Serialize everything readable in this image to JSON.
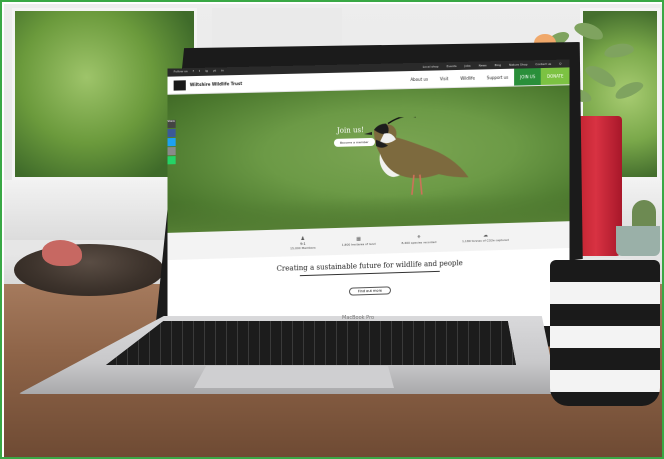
{
  "website": {
    "top_bar": {
      "social": [
        "Follow us",
        "f",
        "t",
        "ig",
        "yt",
        "in"
      ],
      "links": [
        "Local shop",
        "Events",
        "Jobs",
        "News",
        "Blog",
        "Nature Shop",
        "Contact us",
        "Q"
      ]
    },
    "nav": {
      "brand": "Wiltshire Wildlife Trust",
      "links": [
        "About us",
        "Visit",
        "Wildlife",
        "Support us"
      ],
      "join": "JOIN US",
      "donate": "DONATE"
    },
    "hero": {
      "share_label": "Share",
      "heading": "Join us!",
      "button": "Become a member"
    },
    "stats": [
      {
        "num": "9:1",
        "text": "15,000 Members"
      },
      {
        "num": "",
        "text": "1,800 hectares of land"
      },
      {
        "num": "",
        "text": "8,400 species recorded"
      },
      {
        "num": "",
        "text": "1,180 tonnes of CO2e captured"
      }
    ],
    "tagline": "Creating a sustainable future for wildlife and people",
    "cta": "Find out more"
  },
  "laptop_label": "MacBook Pro",
  "colors": {
    "frame": "#39a845",
    "join": "#2a8f3a",
    "donate": "#7cc242"
  }
}
